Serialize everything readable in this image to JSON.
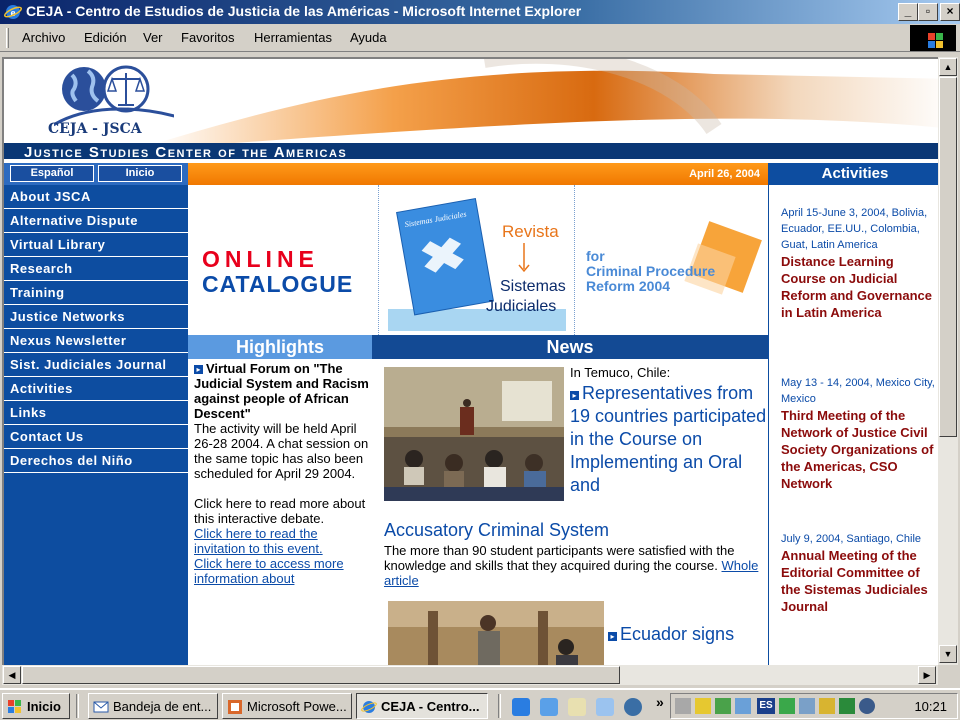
{
  "window": {
    "title": "CEJA - Centro de Estudios de Justicia de las Américas - Microsoft Internet Explorer",
    "buttons": {
      "minimize": "_",
      "maximize": "▫",
      "close": "×"
    }
  },
  "menu": [
    "Archivo",
    "Edición",
    "Ver",
    "Favoritos",
    "Herramientas",
    "Ayuda"
  ],
  "header": {
    "logo_text": "CEJA - JSCA",
    "banner_text": "Justice Studies Center of the Americas"
  },
  "langbar": {
    "espanol": "Español",
    "inicio": "Inicio"
  },
  "date": "April 26, 2004",
  "nav": [
    "About JSCA",
    "Alternative Dispute",
    "Virtual Library",
    "Research",
    "Training",
    "Justice Networks",
    "Nexus Newsletter",
    "Sist. Judiciales Journal",
    "Activities",
    "Links",
    "Contact Us",
    "Derechos del Niño"
  ],
  "banner": {
    "catalogue_line1": "ONLINE",
    "catalogue_line2": "CATALOGUE",
    "magazine_cover": "Sistemas Judiciales",
    "revista": "Revista",
    "sistemas": "Sistemas",
    "judiciales": "Judiciales",
    "for_text_1": "for",
    "for_text_2": "Criminal Procedure",
    "for_text_3": "Reform 2004"
  },
  "highlights": {
    "header": "Highlights",
    "title": "Virtual Forum on \"The Judicial System and Racism against people of African Descent\"",
    "body": "The activity will be held April 26-28 2004. A chat session on the same topic has also been scheduled for April 29 2004.",
    "more": "Click here to read more about this interactive debate.",
    "link1": "Click here to read the invitation to this event.",
    "link2": "Click here to access more information about"
  },
  "news": {
    "header": "News",
    "location": "In Temuco, Chile:",
    "headline_a": "Representatives from 19 countries participated in the Course on Implementing an Oral and",
    "headline_b": "Accusatory Criminal System",
    "body": "The more than 90 student participants were satisfied with the knowledge and skills that they acquired during the course.",
    "link": "Whole article",
    "headline2": "Ecuador signs"
  },
  "activities": {
    "header": "Activities",
    "items": [
      {
        "meta": "April 15-June 3, 2004, Bolivia, Ecuador, EE.UU., Colombia, Guat, Latin America",
        "title": "Distance Learning Course on Judicial Reform and Governance in Latin America"
      },
      {
        "meta": "May 13 - 14, 2004, Mexico City, Mexico",
        "title": "Third Meeting of the Network of Justice Civil Society Organizations of the Americas, CSO Network"
      },
      {
        "meta": "July 9, 2004, Santiago, Chile",
        "title": "Annual Meeting of the Editorial Committee of the Sistemas Judiciales Journal"
      }
    ]
  },
  "taskbar": {
    "start": "Inicio",
    "tasks": [
      "Bandeja de ent...",
      "Microsoft Powe...",
      "CEJA - Centro..."
    ],
    "chevron": "»",
    "lang": "ES",
    "clock": "10:21"
  }
}
